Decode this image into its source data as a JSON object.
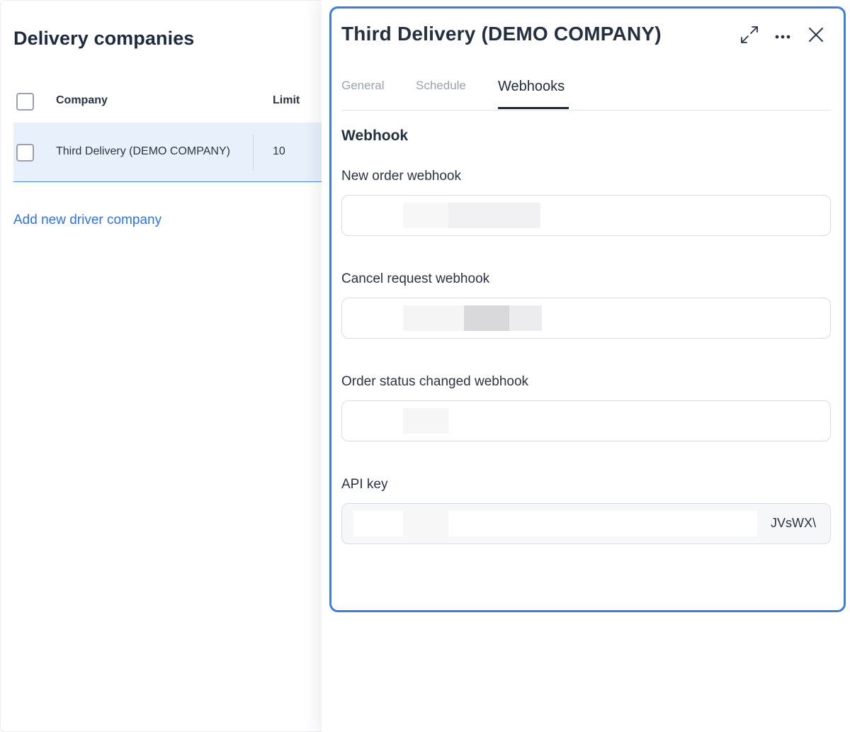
{
  "list": {
    "title": "Delivery companies",
    "columns": {
      "company": "Company",
      "limit": "Limit"
    },
    "rows": [
      {
        "company": "Third Delivery (DEMO COMPANY)",
        "limit": "10",
        "selected": true
      }
    ],
    "add_link": "Add new driver company"
  },
  "drawer": {
    "title": "Third Delivery (DEMO COMPANY)",
    "icons": [
      "expand-icon",
      "more-icon",
      "close-icon"
    ],
    "tabs": [
      {
        "label": "General",
        "active": false
      },
      {
        "label": "Schedule",
        "active": false
      },
      {
        "label": "Webhooks",
        "active": true
      }
    ],
    "section_title": "Webhook",
    "fields": {
      "new_order": {
        "label": "New order webhook",
        "value": ""
      },
      "cancel_request": {
        "label": "Cancel request webhook",
        "value": ""
      },
      "order_status": {
        "label": "Order status changed webhook",
        "value": ""
      },
      "api_key": {
        "label": "API key",
        "value_visible_suffix": "JVsWX\\"
      }
    }
  },
  "colors": {
    "accent": "#3b7de0",
    "link": "#2f74d8",
    "selected_row": "#e8f0fc",
    "text_dark": "#1f2a3c",
    "tab_inactive": "#9aa2ae"
  }
}
